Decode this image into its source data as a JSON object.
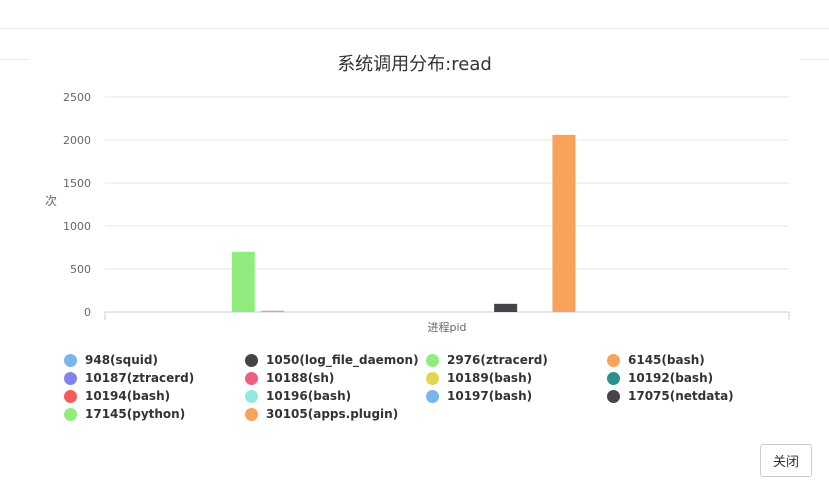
{
  "chart_data": {
    "type": "bar",
    "title": "系统调用分布:read",
    "xlabel": "进程pid",
    "ylabel": "次",
    "ylim": [
      0,
      2500
    ],
    "yticks": [
      0,
      500,
      1000,
      1500,
      2000,
      2500
    ],
    "grid": true,
    "legend_position": "bottom",
    "categories": [
      ""
    ],
    "series": [
      {
        "name": "948(squid)",
        "color": "#7cb5ec",
        "values": [
          0
        ]
      },
      {
        "name": "1050(log_file_daemon)",
        "color": "#434348",
        "values": [
          0
        ]
      },
      {
        "name": "2976(ztracerd)",
        "color": "#90ed7d",
        "values": [
          700
        ]
      },
      {
        "name": "6145(bash)",
        "color": "#f7a35c",
        "values": [
          15
        ]
      },
      {
        "name": "10187(ztracerd)",
        "color": "#8085e9",
        "values": [
          0
        ]
      },
      {
        "name": "10188(sh)",
        "color": "#f15c80",
        "values": [
          0
        ]
      },
      {
        "name": "10189(bash)",
        "color": "#e4d354",
        "values": [
          0
        ]
      },
      {
        "name": "10192(bash)",
        "color": "#2b908f",
        "values": [
          0
        ]
      },
      {
        "name": "10194(bash)",
        "color": "#f45b5b",
        "values": [
          0
        ]
      },
      {
        "name": "10196(bash)",
        "color": "#91e8e1",
        "values": [
          0
        ]
      },
      {
        "name": "10197(bash)",
        "color": "#7cb5ec",
        "values": [
          0
        ]
      },
      {
        "name": "17075(netdata)",
        "color": "#434348",
        "values": [
          95
        ]
      },
      {
        "name": "17145(python)",
        "color": "#90ed7d",
        "values": [
          0
        ]
      },
      {
        "name": "30105(apps.plugin)",
        "color": "#f7a35c",
        "values": [
          2060
        ]
      }
    ]
  },
  "footer": {
    "close_label": "关闭"
  }
}
